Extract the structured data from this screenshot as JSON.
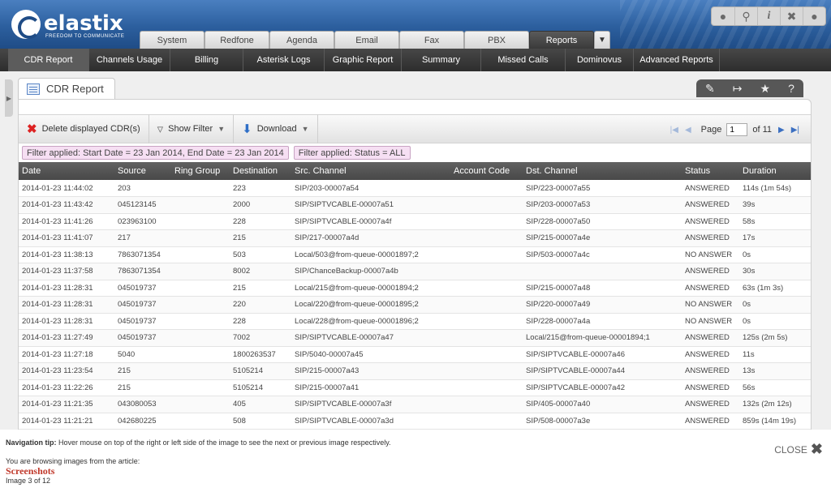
{
  "brand": {
    "name": "elastix",
    "tagline": "FREEDOM TO COMMUNICATE"
  },
  "utility_icons": [
    "drop-icon",
    "search-icon",
    "info-icon",
    "tools-icon",
    "user-icon"
  ],
  "module_tabs": [
    {
      "label": "System"
    },
    {
      "label": "Redfone"
    },
    {
      "label": "Agenda"
    },
    {
      "label": "Email"
    },
    {
      "label": "Fax"
    },
    {
      "label": "PBX"
    },
    {
      "label": "Reports",
      "active": true
    }
  ],
  "submenu": [
    {
      "label": "CDR Report",
      "active": true
    },
    {
      "label": "Channels Usage"
    },
    {
      "label": "Billing"
    },
    {
      "label": "Asterisk Logs"
    },
    {
      "label": "Graphic Report"
    },
    {
      "label": "Summary"
    },
    {
      "label": "Missed Calls"
    },
    {
      "label": "Dominovus"
    },
    {
      "label": "Advanced Reports"
    }
  ],
  "page": {
    "title": "CDR Report"
  },
  "toolbar": {
    "delete_label": "Delete displayed CDR(s)",
    "filter_label": "Show Filter",
    "download_label": "Download",
    "page_label": "Page",
    "page_value": "1",
    "page_of": "of 11"
  },
  "filters": [
    "Filter applied: Start Date = 23 Jan 2014, End Date = 23 Jan 2014",
    "Filter applied: Status = ALL"
  ],
  "table": {
    "columns": [
      "Date",
      "Source",
      "Ring Group",
      "Destination",
      "Src. Channel",
      "Account Code",
      "Dst. Channel",
      "Status",
      "Duration"
    ],
    "rows": [
      [
        "2014-01-23 11:44:02",
        "203",
        "",
        "223",
        "SIP/203-00007a54",
        "",
        "SIP/223-00007a55",
        "ANSWERED",
        "114s (1m 54s)"
      ],
      [
        "2014-01-23 11:43:42",
        "045123145",
        "",
        "2000",
        "SIP/SIPTVCABLE-00007a51",
        "",
        "SIP/203-00007a53",
        "ANSWERED",
        "39s"
      ],
      [
        "2014-01-23 11:41:26",
        "023963100",
        "",
        "228",
        "SIP/SIPTVCABLE-00007a4f",
        "",
        "SIP/228-00007a50",
        "ANSWERED",
        "58s"
      ],
      [
        "2014-01-23 11:41:07",
        "217",
        "",
        "215",
        "SIP/217-00007a4d",
        "",
        "SIP/215-00007a4e",
        "ANSWERED",
        "17s"
      ],
      [
        "2014-01-23 11:38:13",
        "7863071354",
        "",
        "503",
        "Local/503@from-queue-00001897;2",
        "",
        "SIP/503-00007a4c",
        "NO ANSWER",
        "0s"
      ],
      [
        "2014-01-23 11:37:58",
        "7863071354",
        "",
        "8002",
        "SIP/ChanceBackup-00007a4b",
        "",
        "",
        "ANSWERED",
        "30s"
      ],
      [
        "2014-01-23 11:28:31",
        "045019737",
        "",
        "215",
        "Local/215@from-queue-00001894;2",
        "",
        "SIP/215-00007a48",
        "ANSWERED",
        "63s (1m 3s)"
      ],
      [
        "2014-01-23 11:28:31",
        "045019737",
        "",
        "220",
        "Local/220@from-queue-00001895;2",
        "",
        "SIP/220-00007a49",
        "NO ANSWER",
        "0s"
      ],
      [
        "2014-01-23 11:28:31",
        "045019737",
        "",
        "228",
        "Local/228@from-queue-00001896;2",
        "",
        "SIP/228-00007a4a",
        "NO ANSWER",
        "0s"
      ],
      [
        "2014-01-23 11:27:49",
        "045019737",
        "",
        "7002",
        "SIP/SIPTVCABLE-00007a47",
        "",
        "Local/215@from-queue-00001894;1",
        "ANSWERED",
        "125s (2m 5s)"
      ],
      [
        "2014-01-23 11:27:18",
        "5040",
        "",
        "1800263537",
        "SIP/5040-00007a45",
        "",
        "SIP/SIPTVCABLE-00007a46",
        "ANSWERED",
        "11s"
      ],
      [
        "2014-01-23 11:23:54",
        "215",
        "",
        "5105214",
        "SIP/215-00007a43",
        "",
        "SIP/SIPTVCABLE-00007a44",
        "ANSWERED",
        "13s"
      ],
      [
        "2014-01-23 11:22:26",
        "215",
        "",
        "5105214",
        "SIP/215-00007a41",
        "",
        "SIP/SIPTVCABLE-00007a42",
        "ANSWERED",
        "56s"
      ],
      [
        "2014-01-23 11:21:35",
        "043080053",
        "",
        "405",
        "SIP/SIPTVCABLE-00007a3f",
        "",
        "SIP/405-00007a40",
        "ANSWERED",
        "132s (2m 12s)"
      ],
      [
        "2014-01-23 11:21:21",
        "042680225",
        "",
        "508",
        "SIP/SIPTVCABLE-00007a3d",
        "",
        "SIP/508-00007a3e",
        "ANSWERED",
        "859s (14m 19s)"
      ]
    ]
  },
  "gallery": {
    "nav_tip_bold": "Navigation tip:",
    "nav_tip": " Hover mouse on top of the right or left side of the image to see the next or previous image respectively.",
    "browsing": "You are browsing images from the article:",
    "article": "Screenshots",
    "image_count": "Image 3 of 12",
    "close_label": "CLOSE"
  }
}
